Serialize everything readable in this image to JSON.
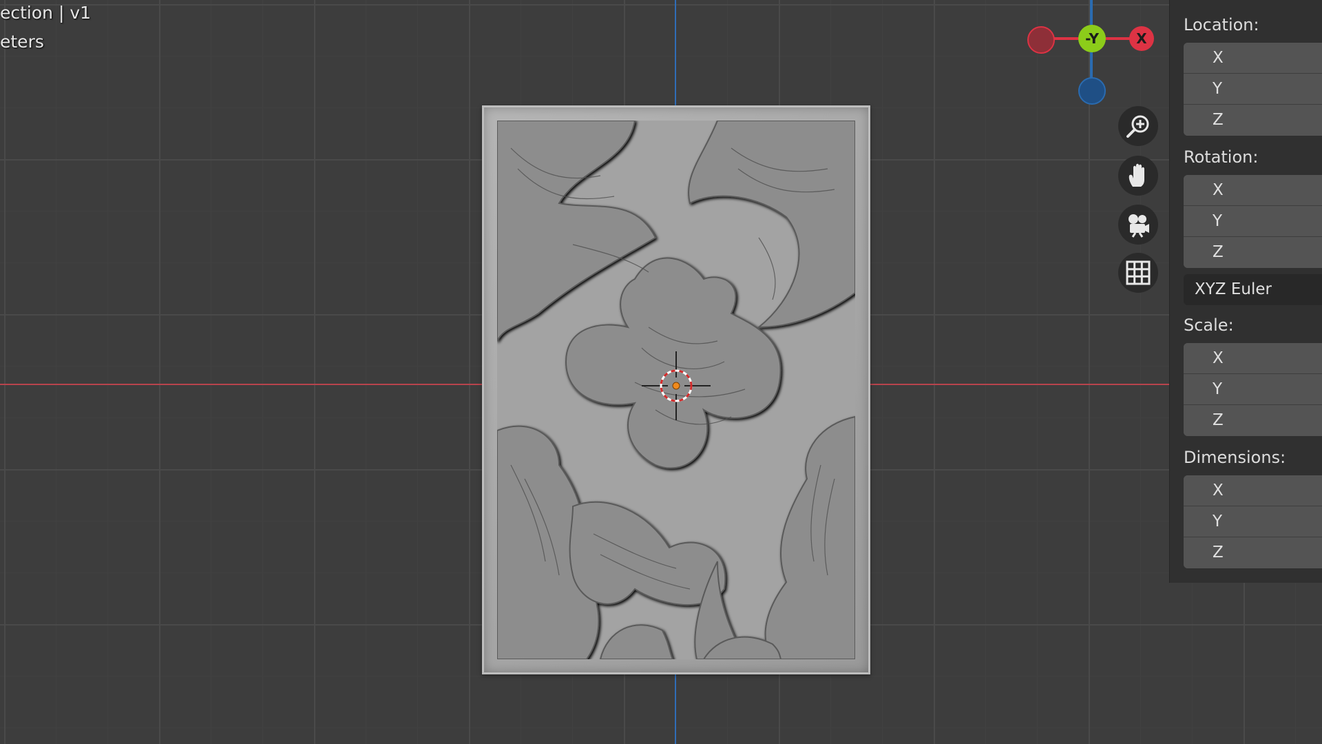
{
  "viewport": {
    "title_line": "ection | v1",
    "units_line": "eters"
  },
  "gizmo": {
    "x_label": "X",
    "neg_y_label": "-Y"
  },
  "panel": {
    "location": {
      "label": "Location:",
      "fields": [
        "X",
        "Y",
        "Z"
      ]
    },
    "rotation": {
      "label": "Rotation:",
      "fields": [
        "X",
        "Y",
        "Z"
      ],
      "mode": "XYZ Euler"
    },
    "scale": {
      "label": "Scale:",
      "fields": [
        "X",
        "Y",
        "Z"
      ]
    },
    "dimensions": {
      "label": "Dimensions:",
      "fields": [
        "X",
        "Y",
        "Z"
      ]
    }
  },
  "colors": {
    "x_axis": "#b8434d",
    "z_axis": "#2f6db8",
    "gizmo_x": "#dd3344",
    "gizmo_y": "#8ccc1a",
    "gizmo_z": "#2a6bb0"
  },
  "icons": [
    "zoom-icon",
    "pan-hand-icon",
    "camera-icon",
    "grid-icon"
  ]
}
